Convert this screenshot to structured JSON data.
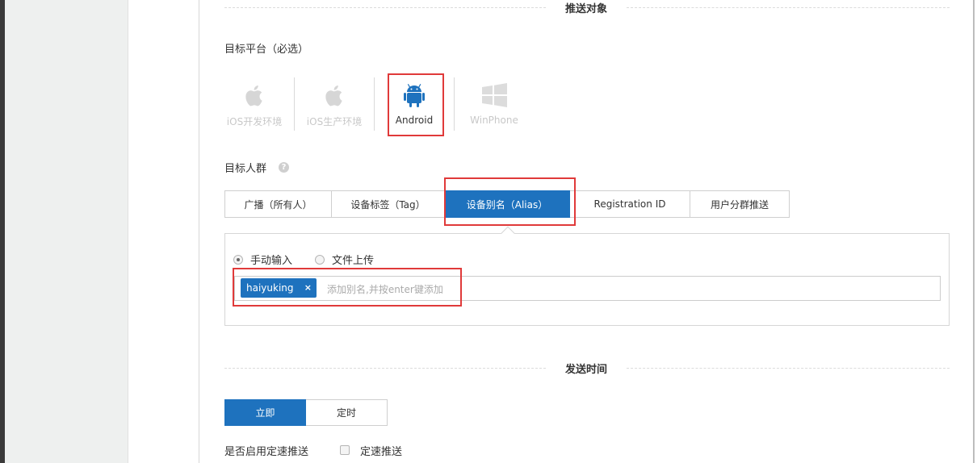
{
  "sections": {
    "target": "推送对象",
    "send_time": "发送时间"
  },
  "platform": {
    "label": "目标平台（必选）",
    "items": [
      {
        "name": "iOS开发环境",
        "icon": "apple-icon",
        "selected": false
      },
      {
        "name": "iOS生产环境",
        "icon": "apple-icon",
        "selected": false
      },
      {
        "name": "Android",
        "icon": "android-icon",
        "selected": true
      },
      {
        "name": "WinPhone",
        "icon": "windows-icon",
        "selected": false
      }
    ]
  },
  "audience": {
    "label": "目标人群",
    "help": "?",
    "tabs": [
      {
        "label": "广播（所有人）",
        "active": false
      },
      {
        "label": "设备标签（Tag）",
        "active": false
      },
      {
        "label": "设备别名（Alias）",
        "active": true
      },
      {
        "label": "Registration ID",
        "active": false
      },
      {
        "label": "用户分群推送",
        "active": false
      }
    ],
    "input_mode": {
      "manual": "手动输入",
      "upload": "文件上传",
      "selected": "manual"
    },
    "alias_tag": "haiyuking",
    "alias_tag_remove": "×",
    "alias_placeholder": "添加别名,并按enter键添加"
  },
  "send_time": {
    "buttons": [
      {
        "label": "立即",
        "active": true
      },
      {
        "label": "定时",
        "active": false
      }
    ],
    "rate_label": "是否启用定速推送",
    "rate_checkbox_label": "定速推送",
    "rate_checked": false
  },
  "colors": {
    "accent": "#1e72be",
    "highlight": "#e03a3a",
    "android_icon": "#1e72be",
    "disabled": "#c8c8c8"
  }
}
